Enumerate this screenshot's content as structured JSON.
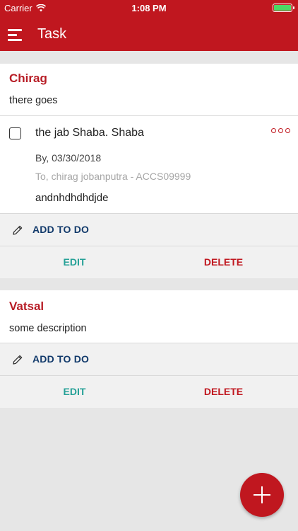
{
  "status_bar": {
    "carrier": "Carrier",
    "time": "1:08 PM"
  },
  "app_bar": {
    "title": "Task",
    "menu_icon": "hamburger-menu-icon"
  },
  "tasks": [
    {
      "user": "Chirag",
      "description": "there goes",
      "todo": {
        "title": "the jab Shaba. Shaba",
        "by": "By, 03/30/2018",
        "to": "To, chirag jobanputra - ACCS09999",
        "note": "andnhdhdhdjde"
      },
      "add_label": "ADD TO DO",
      "edit_label": "EDIT",
      "delete_label": "DELETE"
    },
    {
      "user": "Vatsal",
      "description": "some description",
      "add_label": "ADD TO DO",
      "edit_label": "EDIT",
      "delete_label": "DELETE"
    }
  ],
  "fab": {
    "icon": "plus-icon"
  },
  "colors": {
    "primary": "#c0171f",
    "edit": "#24a096",
    "add": "#123a6b"
  }
}
